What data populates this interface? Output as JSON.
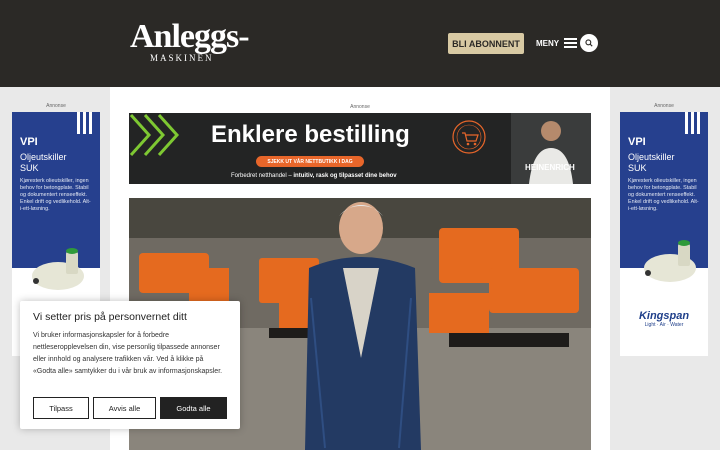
{
  "header": {
    "logo_main": "Anleggs-",
    "logo_sub": "MASKINEN",
    "subscribe_label": "BLI ABONNENT",
    "menu_label": "MENY"
  },
  "ads": {
    "label": "Annonse",
    "side": {
      "brand": "VPI",
      "title_line1": "Oljeutskiller",
      "title_line2": "SUK",
      "body": "Kjøresterk olieutskiller, ingen behov for betongplate. Stabil og dokumentert renseeffekt. Enkel drift og vedlikehold. Alt-i-ett-løsning.",
      "right_brand": "Kingspan",
      "right_tagline": "Light · Air · Water"
    },
    "banner": {
      "title": "Enklere bestilling",
      "cta": "SJEKK UT VÅR NETTBUTIKK I DAG",
      "subtitle_plain": "Forbedret netthandel – ",
      "subtitle_bold": "intuitiv, rask og tilpasset dine behov",
      "brand": "HEINENRICH",
      "stamp_text": "NETTBUTIKK"
    }
  },
  "cookie": {
    "title": "Vi setter pris på personvernet ditt",
    "text": "Vi bruker informasjonskapsler for å forbedre nettleseropplevelsen din, vise personlig tilpassede annonser eller innhold og analysere trafikken vår. Ved å klikke på «Godta alle» samtykker du i vår bruk av informasjonskapsler.",
    "customize": "Tilpass",
    "reject": "Avvis alle",
    "accept": "Godta alle"
  },
  "colors": {
    "header_bg": "#2b2926",
    "subscribe_bg": "#d8c9a3",
    "ad_blue": "#26408e",
    "banner_cta": "#e8662a",
    "banner_green": "#7ec832"
  },
  "icons": [
    "search-icon",
    "hamburger-icon"
  ]
}
